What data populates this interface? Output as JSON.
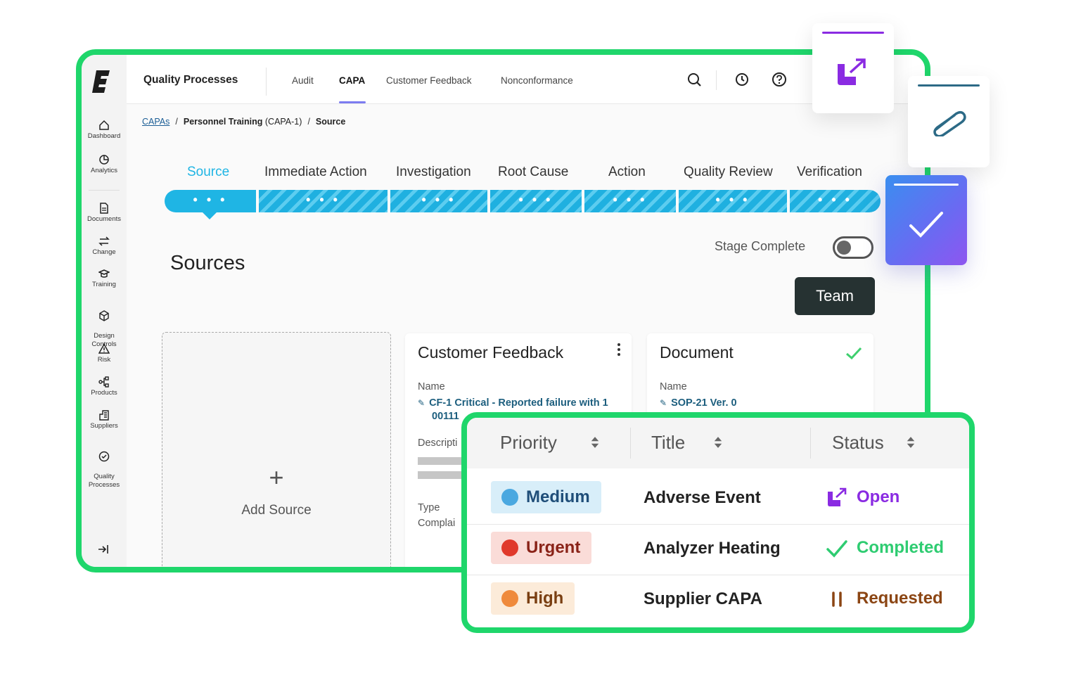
{
  "app": {
    "title": "Quality Processes",
    "top_tabs": [
      "Audit",
      "CAPA",
      "Customer Feedback",
      "Nonconformance"
    ],
    "active_tab": "CAPA"
  },
  "sidebar": {
    "items": [
      {
        "label": "Dashboard",
        "icon": "home-icon"
      },
      {
        "label": "Analytics",
        "icon": "pie-chart-icon"
      },
      {
        "label": "Documents",
        "icon": "document-icon"
      },
      {
        "label": "Change",
        "icon": "swap-arrows-icon"
      },
      {
        "label": "Training",
        "icon": "graduation-cap-icon"
      },
      {
        "label": "Design\nControls",
        "icon": "cube-icon"
      },
      {
        "label": "Risk",
        "icon": "warning-triangle-icon"
      },
      {
        "label": "Products",
        "icon": "hierarchy-icon"
      },
      {
        "label": "Suppliers",
        "icon": "building-icon"
      },
      {
        "label": "Quality\nProcesses",
        "icon": "badge-check-icon"
      }
    ]
  },
  "breadcrumb": {
    "root": "CAPAs",
    "middle": "Personnel Training",
    "middle_id": "(CAPA-1)",
    "current": "Source"
  },
  "stages": [
    "Source",
    "Immediate Action",
    "Investigation",
    "Root Cause",
    "Action",
    "Quality Review",
    "Verification"
  ],
  "active_stage": "Source",
  "stage_dots": "• • •",
  "sources": {
    "title": "Sources",
    "stage_complete_label": "Stage Complete",
    "stage_complete": false,
    "team_button": "Team",
    "add_source_plus": "+",
    "add_source_label": "Add Source"
  },
  "cards": {
    "customer_feedback": {
      "title": "Customer Feedback",
      "name_label": "Name",
      "name_value_line1": "CF-1 Critical - Reported failure with 1",
      "name_value_line2": "00111",
      "description_label": "Descripti",
      "type_label": "Type",
      "type_value": "Complai"
    },
    "document": {
      "title": "Document",
      "name_label": "Name",
      "name_value": "SOP-21 Ver. 0"
    }
  },
  "table": {
    "headers": {
      "priority": "Priority",
      "title": "Title",
      "status": "Status"
    },
    "rows": [
      {
        "priority": "Medium",
        "title": "Adverse Event",
        "status": "Open",
        "priority_color": "#4aa8e0",
        "priority_bg": "#d8eef9",
        "priority_text": "#1f4e79",
        "status_color": "#8a2be2",
        "status_icon": "open-arrow-icon"
      },
      {
        "priority": "Urgent",
        "title": "Analyzer Heating",
        "status": "Completed",
        "priority_color": "#e0392b",
        "priority_bg": "#fadcd8",
        "priority_text": "#8a2318",
        "status_color": "#2ecc71",
        "status_icon": "check-icon"
      },
      {
        "priority": "High",
        "title": "Supplier CAPA",
        "status": "Requested",
        "priority_color": "#ef8a3c",
        "priority_bg": "#fcebd9",
        "priority_text": "#7a3f12",
        "status_color": "#8b4513",
        "status_icon": "pause-icon"
      }
    ]
  },
  "colors": {
    "frame_green": "#1fd66b",
    "stage_blue": "#1fb5e4",
    "team_button_bg": "#263232",
    "purple_accent": "#8a2be2"
  }
}
